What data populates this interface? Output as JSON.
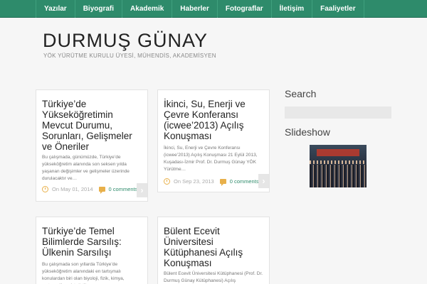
{
  "nav": {
    "items": [
      "Yazılar",
      "Biyografi",
      "Akademik",
      "Haberler",
      "Fotograflar",
      "İletişim",
      "Faaliyetler"
    ]
  },
  "header": {
    "title": "DURMUŞ GÜNAY",
    "tagline": "YÖK YÜRÜTME KURULU ÜYESİ, MÜHENDİS, AKADEMİSYEN"
  },
  "posts": [
    {
      "title": "Türkiye’de Yükseköğretimin Mevcut Durumu, Sorunları, Gelişmeler ve Öneriler",
      "excerpt": "Bu çalışmada, günümüzde, Türkiye’de yükseköğretim alanında son seksen yılda yaşanan değişimler ve gelişmeler üzerinde durulacaktır ve…",
      "date": "On May 01, 2014",
      "comments": "0 comments"
    },
    {
      "title": "İkinci, Su, Enerji ve Çevre Konferansı (icwee’2013) Açılış Konuşması",
      "excerpt": "İkinci, Su, Enerji ve Çevre Konferansı (icwee’2013) Açılış Konuşması 21 Eylül 2013, Kuşadası-İzmir Prof. Dr. Durmuş Günay YÖK Yürütme…",
      "date": "On Sep 23, 2013",
      "comments": "0 comments"
    },
    {
      "title": "Türkiye’de Temel Bilimlerde Sarsılış: Ülkenin Sarsılışı",
      "excerpt": "Bu çalışmada son yıllarda Türkiye’de yükseköğretim alanındaki en tartışmalı konulardan biri olan biyoloji, fizik, kimya, matematik ve istatistik…"
    },
    {
      "title": "Bülent Ecevit Üniversitesi Kütüphanesi Açılış Konuşması",
      "excerpt": "Bülent Ecevit Üniversitesi Kütüphanesi (Prof. Dr. Durmuş Günay Kütüphanesi) Açılış Konuşması…"
    }
  ],
  "sidebar": {
    "search_heading": "Search",
    "slideshow_heading": "Slideshow"
  },
  "colors": {
    "nav_bg": "#2e8b6b",
    "accent": "#e8b04a",
    "link": "#2e8b6b"
  }
}
